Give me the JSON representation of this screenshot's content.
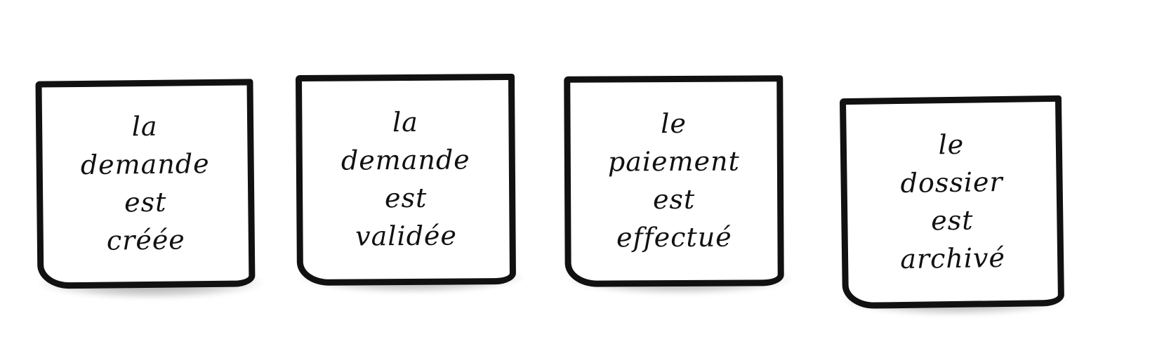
{
  "stickies": [
    {
      "text": "la\ndemande\nest\ncréée"
    },
    {
      "text": "la\ndemande\nest\nvalidée"
    },
    {
      "text": "le\npaiement\nest\neffectué"
    },
    {
      "text": "le\ndossier\nest\narchivé"
    }
  ]
}
